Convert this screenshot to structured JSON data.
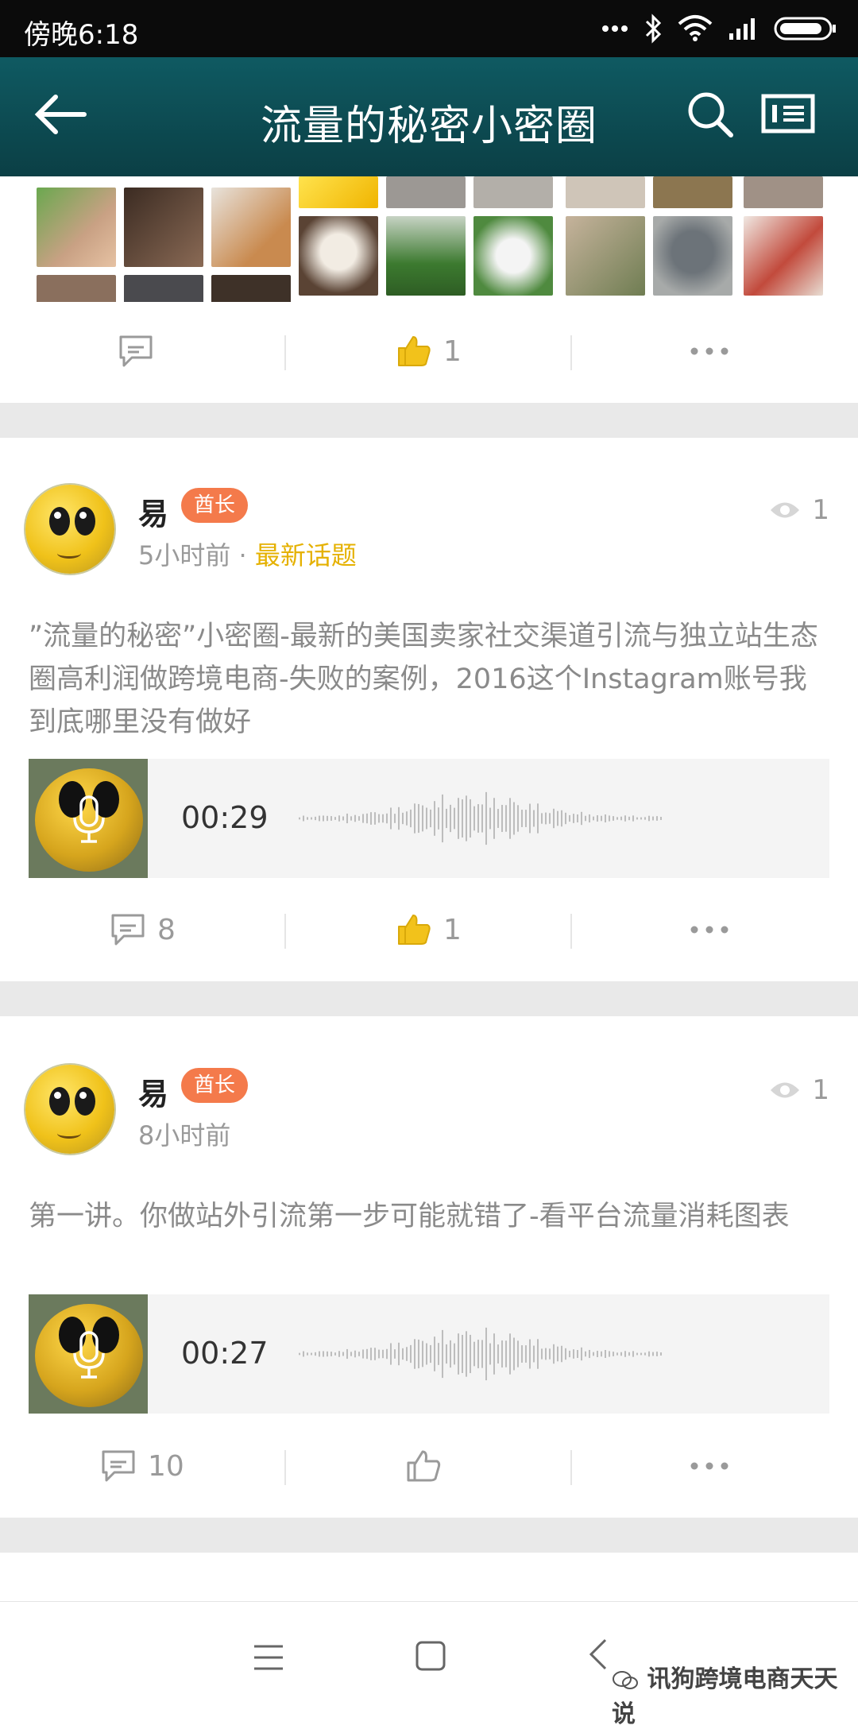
{
  "status_bar": {
    "time": "傍晚6:18"
  },
  "navbar": {
    "title": "流量的秘密小密圈"
  },
  "first_post_actions": {
    "like_count": "1"
  },
  "posts": [
    {
      "author": "易",
      "badge": "酋长",
      "time": "5小时前",
      "separator": "·",
      "topic": "最新话题",
      "views": "1",
      "text": "”流量的秘密”小密圈-最新的美国卖家社交渠道引流与独立站生态圈高利润做跨境电商-失败的案例，2016这个Instagram账号我到底哪里没有做好",
      "audio_duration": "00:29",
      "comment_count": "8",
      "like_count": "1"
    },
    {
      "author": "易",
      "badge": "酋长",
      "time": "8小时前",
      "views": "1",
      "text": "第一讲。你做站外引流第一步可能就错了-看平台流量消耗图表",
      "audio_duration": "00:27",
      "comment_count": "10",
      "like_count": ""
    }
  ],
  "watermark": "讯狗跨境电商天天说",
  "colors": {
    "nav_bg": "#0f5a62",
    "badge": "#f47a4b",
    "topic": "#e5b100",
    "like": "#f2c21b"
  }
}
